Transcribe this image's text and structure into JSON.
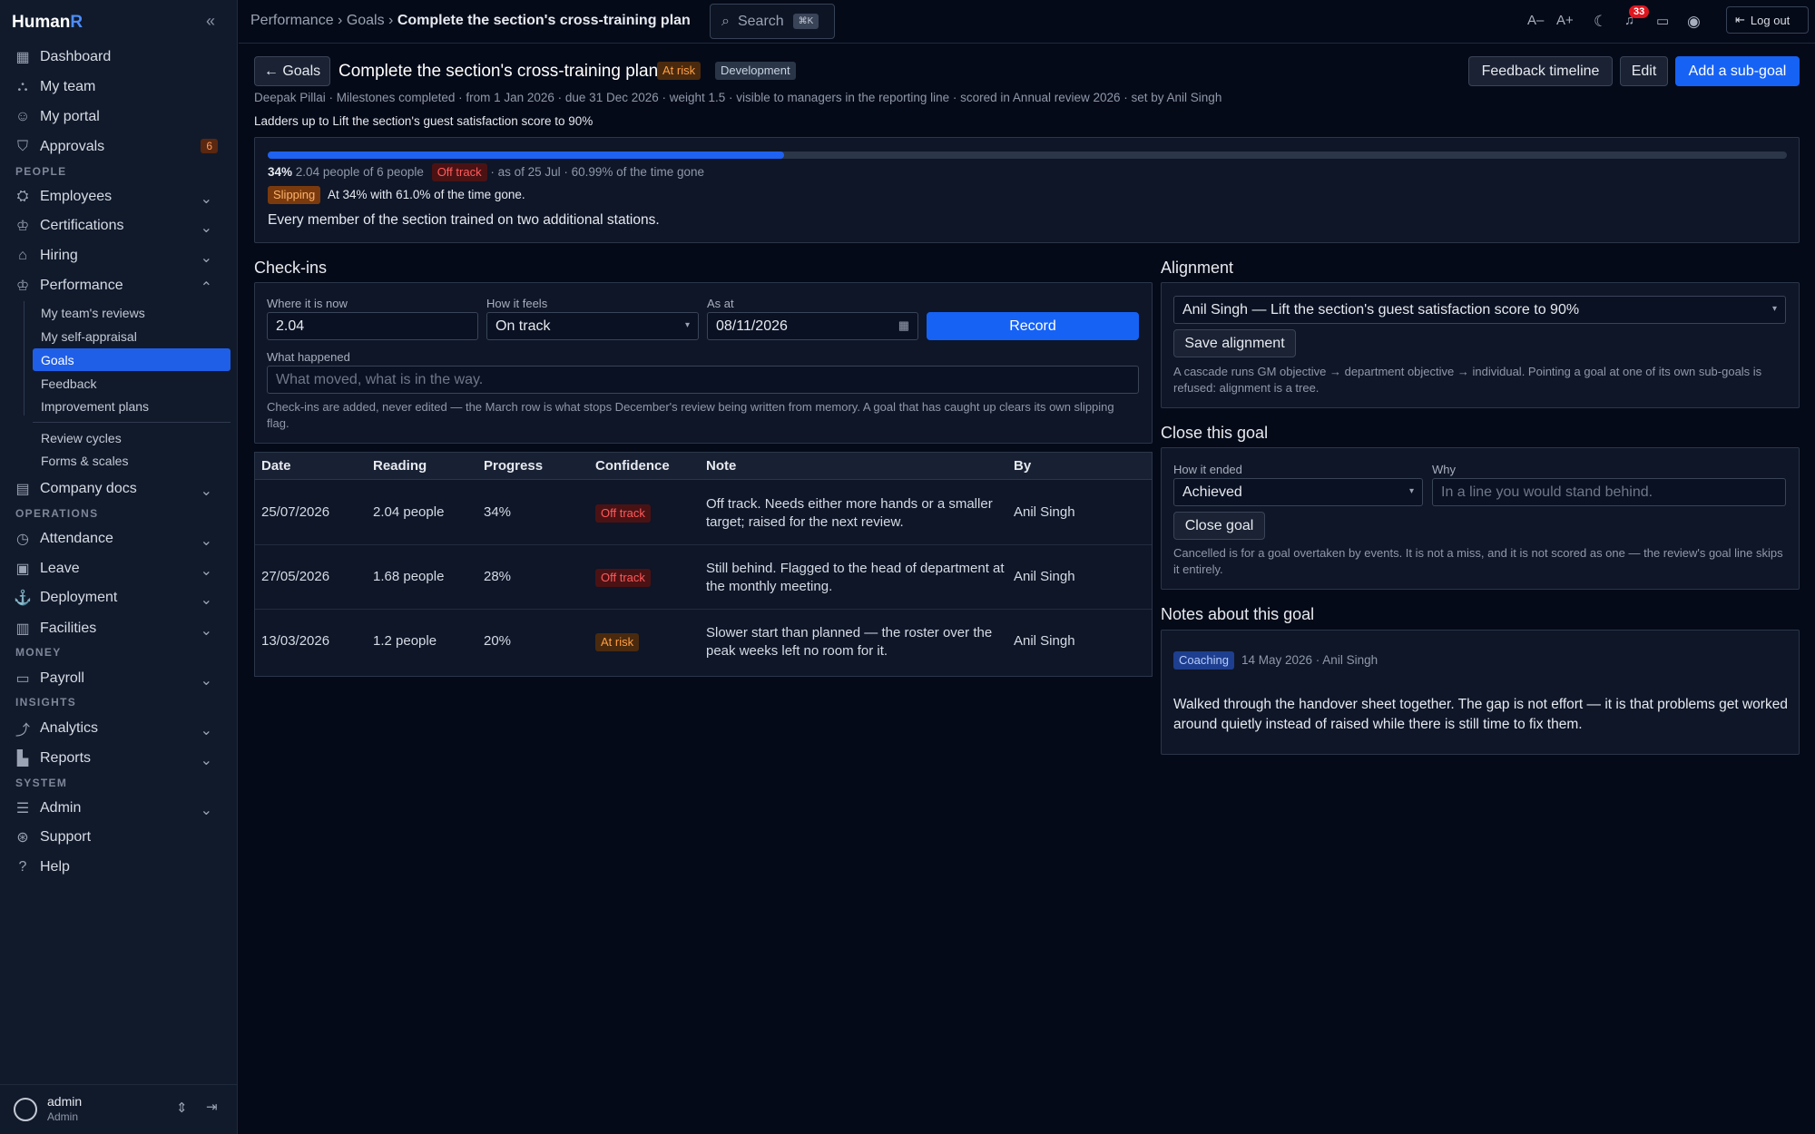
{
  "app": {
    "brand_main": "Human",
    "brand_accent": "R"
  },
  "sidebar": {
    "items": [
      {
        "label": "Dashboard"
      },
      {
        "label": "My team"
      },
      {
        "label": "My portal"
      },
      {
        "label": "Approvals",
        "badge": "6"
      },
      {
        "label": "Employees"
      },
      {
        "label": "Certifications"
      },
      {
        "label": "Hiring"
      },
      {
        "label": "Performance"
      },
      {
        "label": "Company docs"
      },
      {
        "label": "Attendance"
      },
      {
        "label": "Leave"
      },
      {
        "label": "Deployment"
      },
      {
        "label": "Facilities"
      },
      {
        "label": "Payroll"
      },
      {
        "label": "Analytics"
      },
      {
        "label": "Reports"
      },
      {
        "label": "Admin"
      },
      {
        "label": "Support"
      },
      {
        "label": "Help"
      }
    ],
    "sections": [
      "PEOPLE",
      "OPERATIONS",
      "MONEY",
      "INSIGHTS",
      "SYSTEM"
    ],
    "performance_sub": [
      "My team's reviews",
      "My self-appraisal",
      "Goals",
      "Feedback",
      "Improvement plans",
      "Review cycles",
      "Forms & scales"
    ],
    "user": {
      "name": "admin",
      "role": "Admin"
    }
  },
  "topbar": {
    "crumb1": "Performance",
    "crumb2": "Goals",
    "crumb3": "Complete the section's cross-training plan",
    "search_label": "Search",
    "search_kbd": "⌘K",
    "font_down": "A–",
    "font_up": "A+",
    "notif_count": "33",
    "logout": "Log out"
  },
  "goal": {
    "back": "← Goals",
    "title": "Complete the section's cross-training plan",
    "status_pill": "At risk",
    "category_pill": "Development",
    "meta": "Deepak Pillai · Milestones completed · from 1 Jan 2026 · due 31 Dec 2026 · weight 1.5 · visible to managers in the reporting line · scored in Annual review 2026 · set by Anil Singh",
    "ladder": "Ladders up to Lift the section's guest satisfaction score to 90%",
    "actions": {
      "timeline": "Feedback timeline",
      "edit": "Edit",
      "add_sub": "Add a sub-goal"
    },
    "progress": {
      "fraction": 0.34,
      "pct_label": "34%",
      "of_label": "2.04 people of 6 people",
      "track_pill": "Off track",
      "asof": "· as of 25 Jul · 60.99% of the time gone",
      "slip_pill": "Slipping",
      "slip_text": "At 34% with 61.0% of the time gone.",
      "description": "Every member of the section trained on two additional stations."
    }
  },
  "checkins": {
    "heading": "Check-ins",
    "where_label": "Where it is now",
    "where_value": "2.04",
    "feel_label": "How it feels",
    "feel_value": "On track",
    "asat_label": "As at",
    "asat_value": "08/11/2026",
    "record": "Record",
    "happened_label": "What happened",
    "happened_placeholder": "What moved, what is in the way.",
    "hint": "Check-ins are added, never edited — the March row is what stops December's review being written from memory. A goal that has caught up clears its own slipping flag.",
    "columns": [
      "Date",
      "Reading",
      "Progress",
      "Confidence",
      "Note",
      "By"
    ],
    "rows": [
      {
        "date": "25/07/2026",
        "reading": "2.04 people",
        "progress": "34%",
        "confidence": "Off track",
        "note": "Off track. Needs either more hands or a smaller target; raised for the next review.",
        "by": "Anil Singh"
      },
      {
        "date": "27/05/2026",
        "reading": "1.68 people",
        "progress": "28%",
        "confidence": "Off track",
        "note": "Still behind. Flagged to the head of department at the monthly meeting.",
        "by": "Anil Singh"
      },
      {
        "date": "13/03/2026",
        "reading": "1.2 people",
        "progress": "20%",
        "confidence": "At risk",
        "note": "Slower start than planned — the roster over the peak weeks left no room for it.",
        "by": "Anil Singh"
      }
    ]
  },
  "alignment": {
    "heading": "Alignment",
    "select_value": "Anil Singh — Lift the section's guest satisfaction score to 90%",
    "save": "Save alignment",
    "hint": "A cascade runs GM objective → department objective → individual. Pointing a goal at one of its own sub-goals is refused: alignment is a tree."
  },
  "close": {
    "heading": "Close this goal",
    "ended_label": "How it ended",
    "ended_value": "Achieved",
    "why_label": "Why",
    "why_placeholder": "In a line you would stand behind.",
    "button": "Close goal",
    "hint": "Cancelled is for a goal overtaken by events. It is not a miss, and it is not scored as one — the review's goal line skips it entirely."
  },
  "notes": {
    "heading": "Notes about this goal",
    "pill": "Coaching",
    "meta": "14 May 2026 · Anil Singh",
    "body": "Walked through the handover sheet together. The gap is not effort — it is that problems get worked around quietly instead of raised while there is still time to fix them."
  }
}
